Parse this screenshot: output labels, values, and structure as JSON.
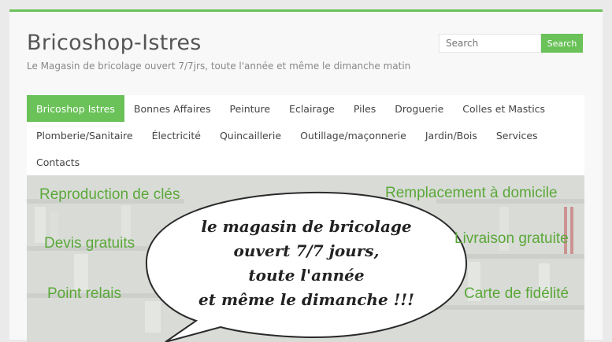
{
  "site": {
    "title": "Bricoshop-Istres",
    "description": "Le Magasin de bricolage ouvert 7/7jrs, toute l'année et même le dimanche matin"
  },
  "search": {
    "placeholder": "Search",
    "button_label": "Search"
  },
  "nav": {
    "rows": [
      [
        "Bricoshop Istres",
        "Bonnes Affaires",
        "Peinture",
        "Eclairage",
        "Piles",
        "Droguerie",
        "Colles et Mastics"
      ],
      [
        "Plomberie/Sanitaire",
        "Électricité",
        "Quincaillerie",
        "Outillage/maçonnerie",
        "Jardin/Bois",
        "Services"
      ],
      [
        "Contacts"
      ]
    ],
    "active": "Bricoshop Istres"
  },
  "banner": {
    "left": [
      "Reproduction de clés",
      "Devis gratuits",
      "Point relais"
    ],
    "right": [
      "Remplacement à domicile",
      "Livraison gratuite",
      "Carte de fidélité"
    ],
    "bubble": [
      "le magasin de bricolage",
      "ouvert 7/7 jours,",
      "toute l'année",
      "et même le dimanche !!!"
    ]
  },
  "colors": {
    "accent": "#6ac259",
    "banner_text": "#5aa838"
  }
}
